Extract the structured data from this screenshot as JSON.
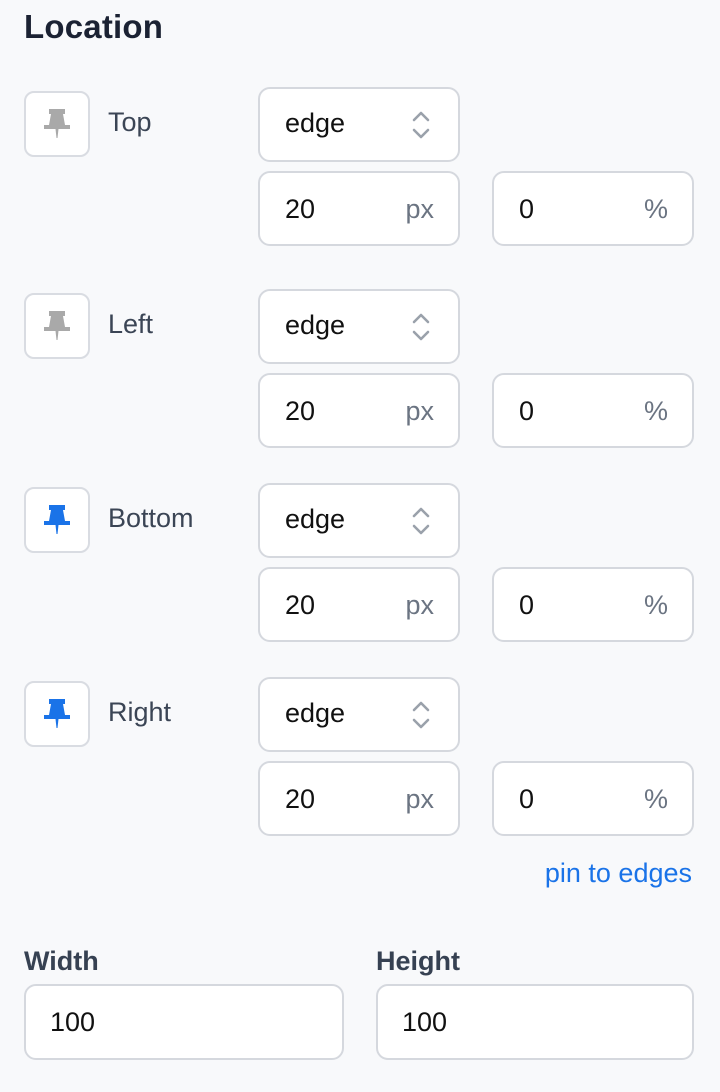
{
  "title": "Location",
  "colors": {
    "accent": "#1a73e8",
    "pin_inactive": "#a9a9a9",
    "pin_active": "#1a73e8"
  },
  "sides": [
    {
      "label": "Top",
      "pinned": false,
      "mode": "edge",
      "offset_px": "20",
      "px_unit": "px",
      "offset_pct": "0",
      "pct_unit": "%"
    },
    {
      "label": "Left",
      "pinned": false,
      "mode": "edge",
      "offset_px": "20",
      "px_unit": "px",
      "offset_pct": "0",
      "pct_unit": "%"
    },
    {
      "label": "Bottom",
      "pinned": true,
      "mode": "edge",
      "offset_px": "20",
      "px_unit": "px",
      "offset_pct": "0",
      "pct_unit": "%"
    },
    {
      "label": "Right",
      "pinned": true,
      "mode": "edge",
      "offset_px": "20",
      "px_unit": "px",
      "offset_pct": "0",
      "pct_unit": "%"
    }
  ],
  "pin_to_edges_label": "pin to edges",
  "size": {
    "width_label": "Width",
    "width_value": "100",
    "height_label": "Height",
    "height_value": "100"
  },
  "icons": {
    "pin": "pushpin-icon",
    "select": "chevron-up-down-icon"
  }
}
